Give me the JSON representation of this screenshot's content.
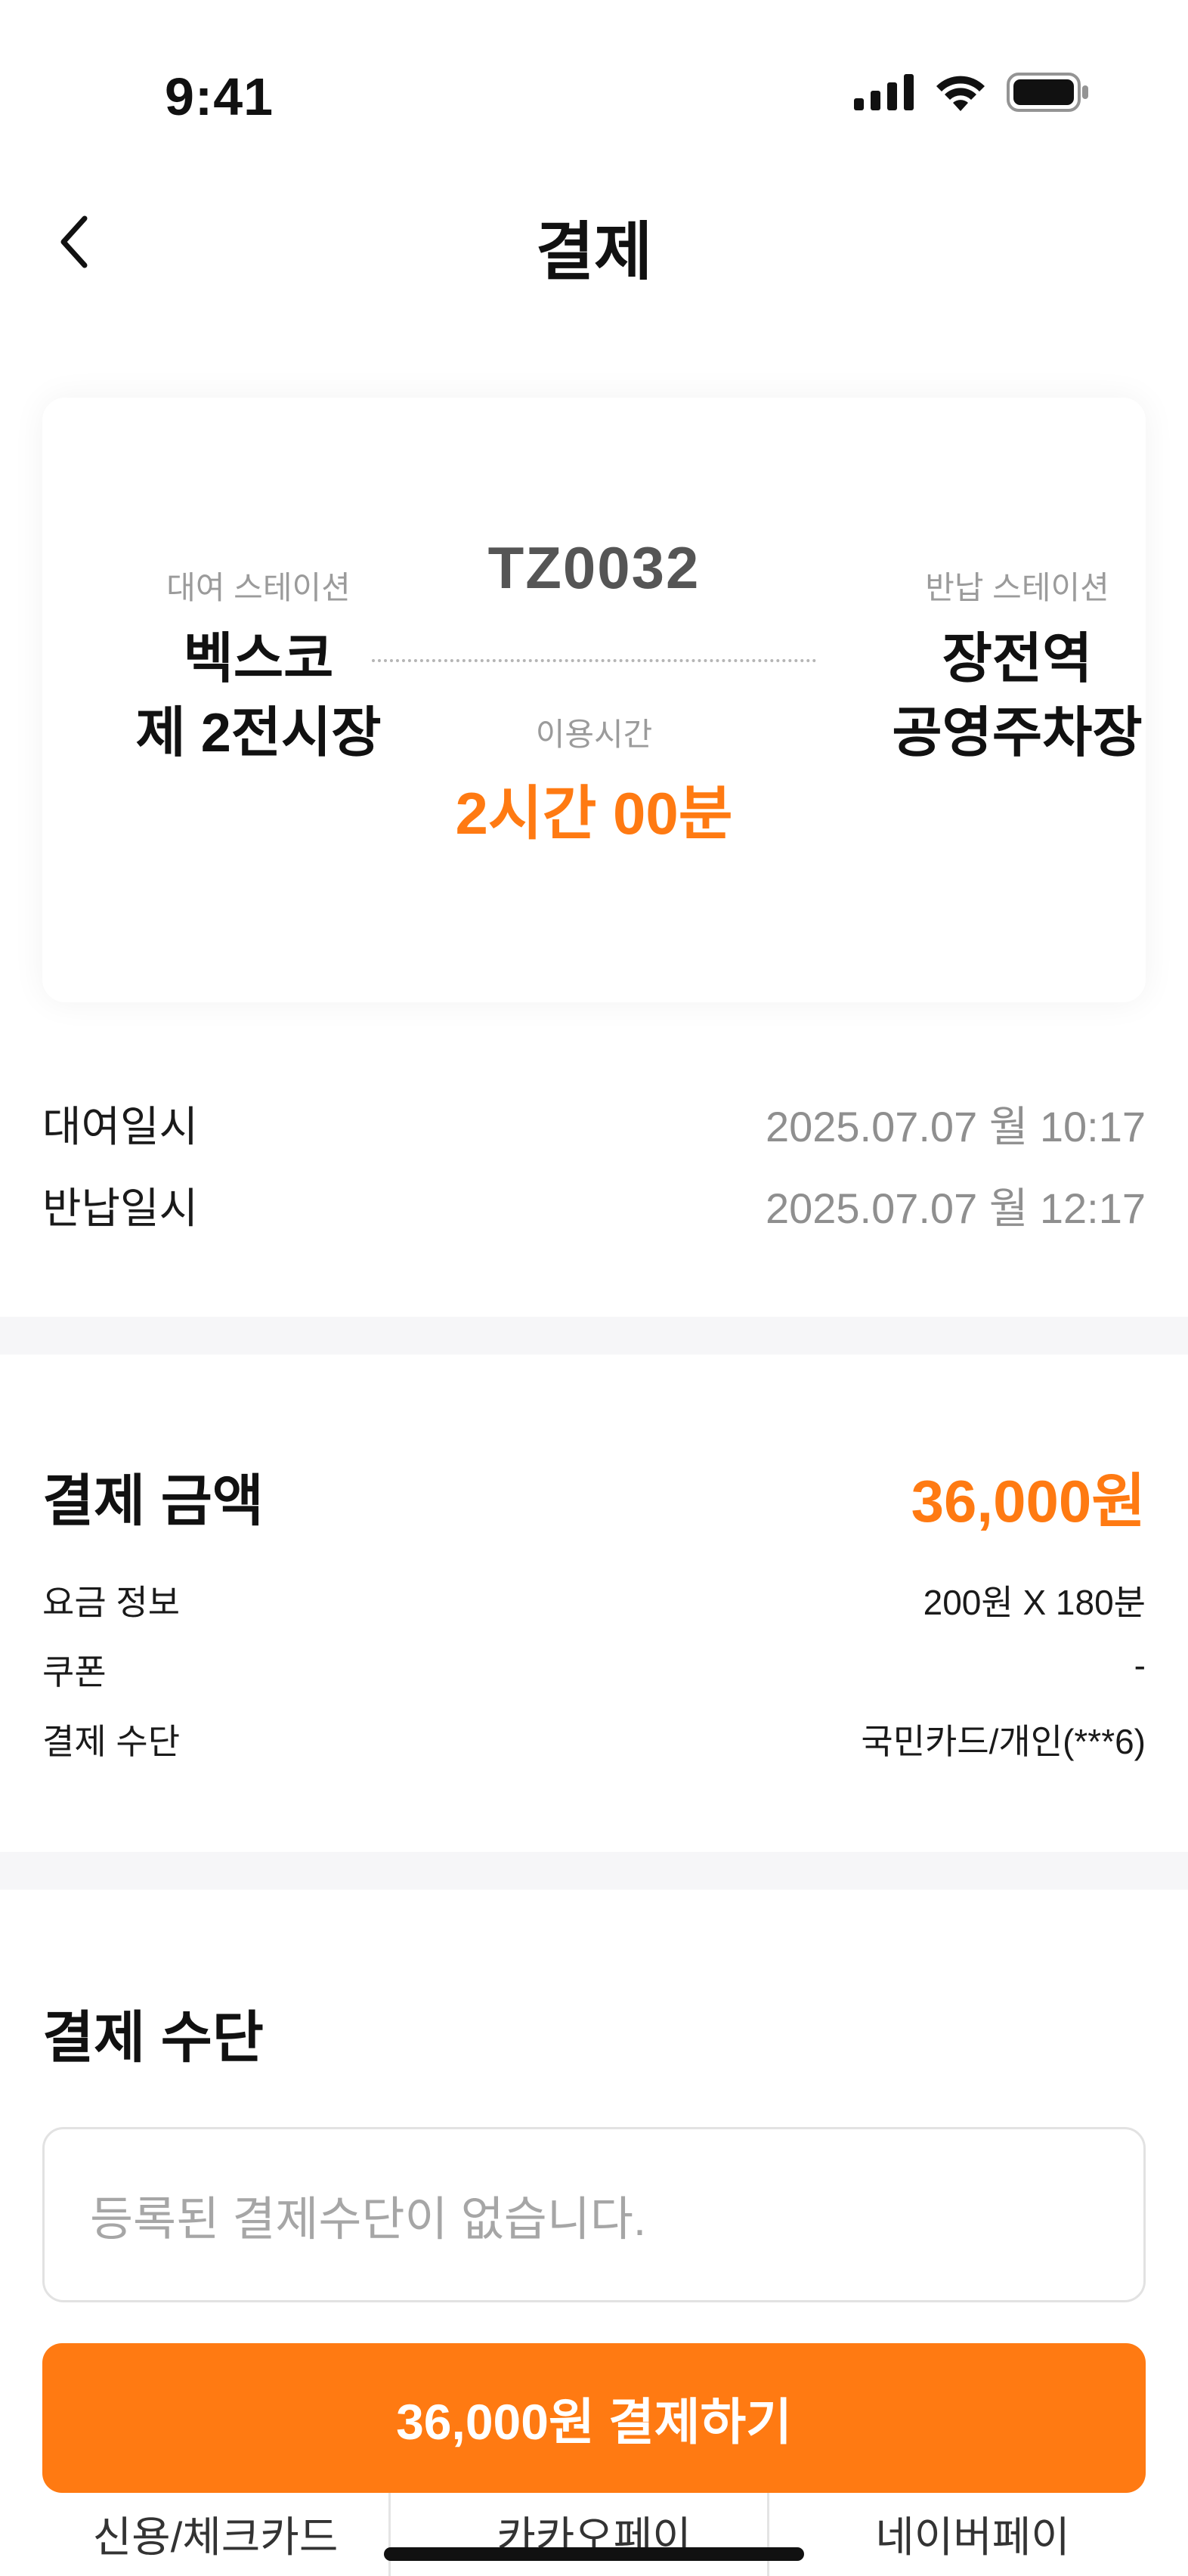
{
  "status_bar": {
    "time": "9:41",
    "icons": [
      "signal-icon",
      "wifi-icon",
      "battery-icon"
    ]
  },
  "header": {
    "back_icon": "chevron-left-icon",
    "title": "결제"
  },
  "ride": {
    "rent_station_caption": "대여 스테이션",
    "rent_station_name": "벡스코\n제 2전시장",
    "vehicle_id": "TZ0032",
    "usage_caption": "이용시간",
    "usage_time": "2시간 00분",
    "return_station_caption": "반납 스테이션",
    "return_station_name": "장전역\n공영주차장"
  },
  "dates": [
    {
      "label": "대여일시",
      "value": "2025.07.07 월 10:17"
    },
    {
      "label": "반납일시",
      "value": "2025.07.07 월 12:17"
    }
  ],
  "payment_amount": {
    "title": "결제 금액",
    "amount": "36,000원",
    "rows": [
      {
        "label": "요금 정보",
        "value": "200원 X 180분"
      },
      {
        "label": "쿠폰",
        "value": "-"
      },
      {
        "label": "결제 수단",
        "value": "국민카드/개인(***6)"
      }
    ]
  },
  "payment_method": {
    "title": "결제 수단",
    "empty_text": "등록된 결제수단이 없습니다.",
    "tabs": [
      "신용/체크카드",
      "카카오페이",
      "네이버페이"
    ]
  },
  "pay_button_label": "36,000원 결제하기",
  "colors": {
    "accent": "#ff7a12",
    "muted_text": "#8f8f8f",
    "divider": "#f6f6f8"
  }
}
